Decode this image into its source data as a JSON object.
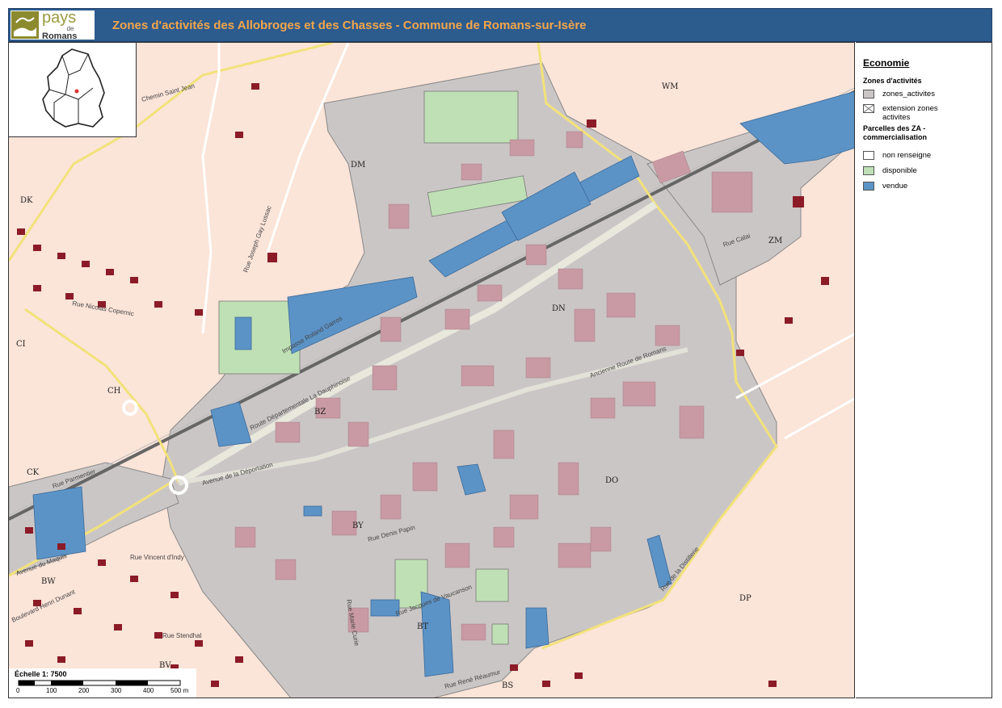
{
  "header": {
    "logo_text": "pays",
    "logo_de": "de",
    "logo_romans": "Romans",
    "title": "Zones d'activités des Allobroges et des Chasses - Commune de Romans-sur-Isère"
  },
  "legend": {
    "heading": "Economie",
    "zones_title": "Zones d'activités",
    "items": [
      {
        "label": "zones_activites",
        "color": "#cbc6c6"
      },
      {
        "label": "extension zones activites",
        "color": "#ffffff"
      }
    ],
    "parcels_title": "Parcelles des ZA - commercialisation",
    "parcels": [
      {
        "label": "non renseigne",
        "color": "#ffffff"
      },
      {
        "label": "disponible",
        "color": "#bfe0b4"
      },
      {
        "label": "vendue",
        "color": "#5b93c6"
      }
    ]
  },
  "scale": {
    "label": "Échelle 1: 7500",
    "ticks": [
      "0",
      "100",
      "200",
      "300",
      "400",
      "500 m"
    ]
  },
  "map": {
    "section_labels": [
      "WM",
      "DM",
      "DK",
      "ZM",
      "DN",
      "CI",
      "CH",
      "BZ",
      "CK",
      "DO",
      "BY",
      "BW",
      "DP",
      "BT",
      "BV",
      "BS"
    ],
    "streets": [
      "Route Départementale La Dauphinoise",
      "Ancienne Route de Romans",
      "Rue de la Distillerie",
      "Avenue de la Déportation",
      "Boulevard Henri Dunant",
      "Rue Joseph Gay Lussac",
      "Impasse Roland Garros",
      "Rue Nicolas Copernic",
      "Rue Parmentier",
      "Rue Vincent d'Indy",
      "Rue Stendhal",
      "Avenue du Maquis",
      "Rue Jacques de Vaucanson",
      "Rue René Réaumur",
      "Rue Denis Papin",
      "Chemin Saint Jean",
      "Rue Marie Curie",
      "Rue Calai"
    ]
  }
}
